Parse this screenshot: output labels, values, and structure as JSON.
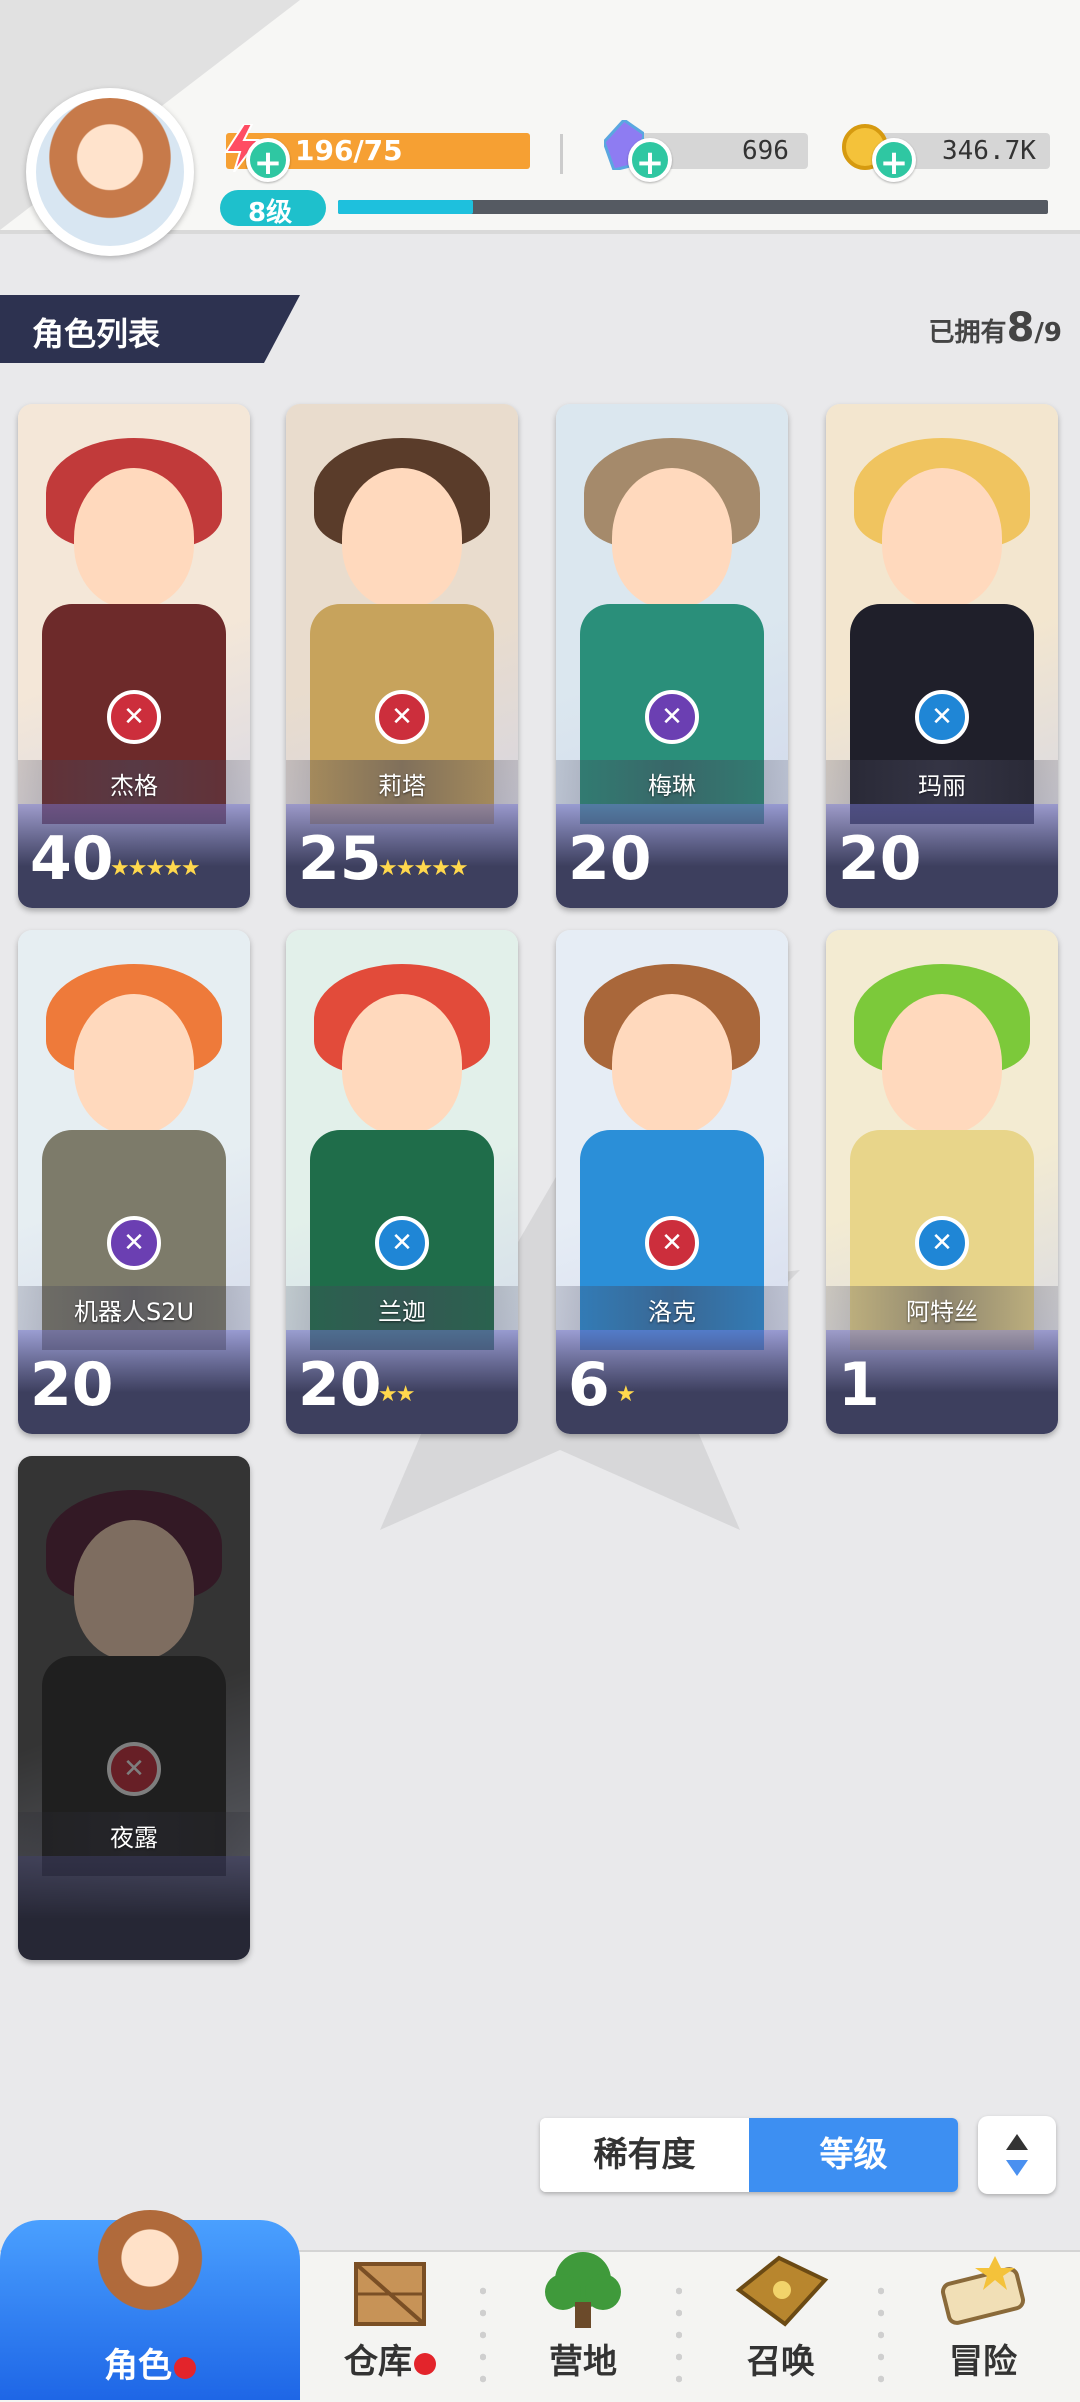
{
  "header": {
    "stamina": "196/75",
    "gems": "696",
    "coins": "346.7K",
    "level_badge": "8级",
    "exp_fraction": 0.19
  },
  "section": {
    "title": "角色列表",
    "owned_prefix": "已拥有",
    "owned_count": "8",
    "owned_total": "/9"
  },
  "characters": [
    {
      "name": "杰格",
      "level": "40",
      "stars": "★★★★★",
      "role_icon": "swords-icon",
      "role_color": "#cc2e3c"
    },
    {
      "name": "莉塔",
      "level": "25",
      "stars": "★★★★★",
      "role_icon": "swords-icon",
      "role_color": "#cc2e3c"
    },
    {
      "name": "梅琳",
      "level": "20",
      "stars": "",
      "role_icon": "magic-icon",
      "role_color": "#6b3fb2"
    },
    {
      "name": "玛丽",
      "level": "20",
      "stars": "",
      "role_icon": "support-icon",
      "role_color": "#1f86d6"
    },
    {
      "name": "机器人S2U",
      "level": "20",
      "stars": "",
      "role_icon": "magic-icon",
      "role_color": "#6b3fb2"
    },
    {
      "name": "兰迦",
      "level": "20",
      "stars": "★★",
      "role_icon": "support-icon",
      "role_color": "#1f86d6"
    },
    {
      "name": "洛克",
      "level": "6",
      "stars": "★",
      "role_icon": "swords-icon",
      "role_color": "#cc2e3c"
    },
    {
      "name": "阿特丝",
      "level": "1",
      "stars": "",
      "role_icon": "support-icon",
      "role_color": "#1f86d6"
    },
    {
      "name": "夜露",
      "level": "",
      "stars": "",
      "role_icon": "swords-icon",
      "role_color": "#cc2e3c",
      "locked": true
    }
  ],
  "sort": {
    "rarity_label": "稀有度",
    "level_label": "等级"
  },
  "nav": {
    "role": "角色",
    "warehouse": "仓库",
    "camp": "营地",
    "summon": "召唤",
    "adventure": "冒险"
  }
}
